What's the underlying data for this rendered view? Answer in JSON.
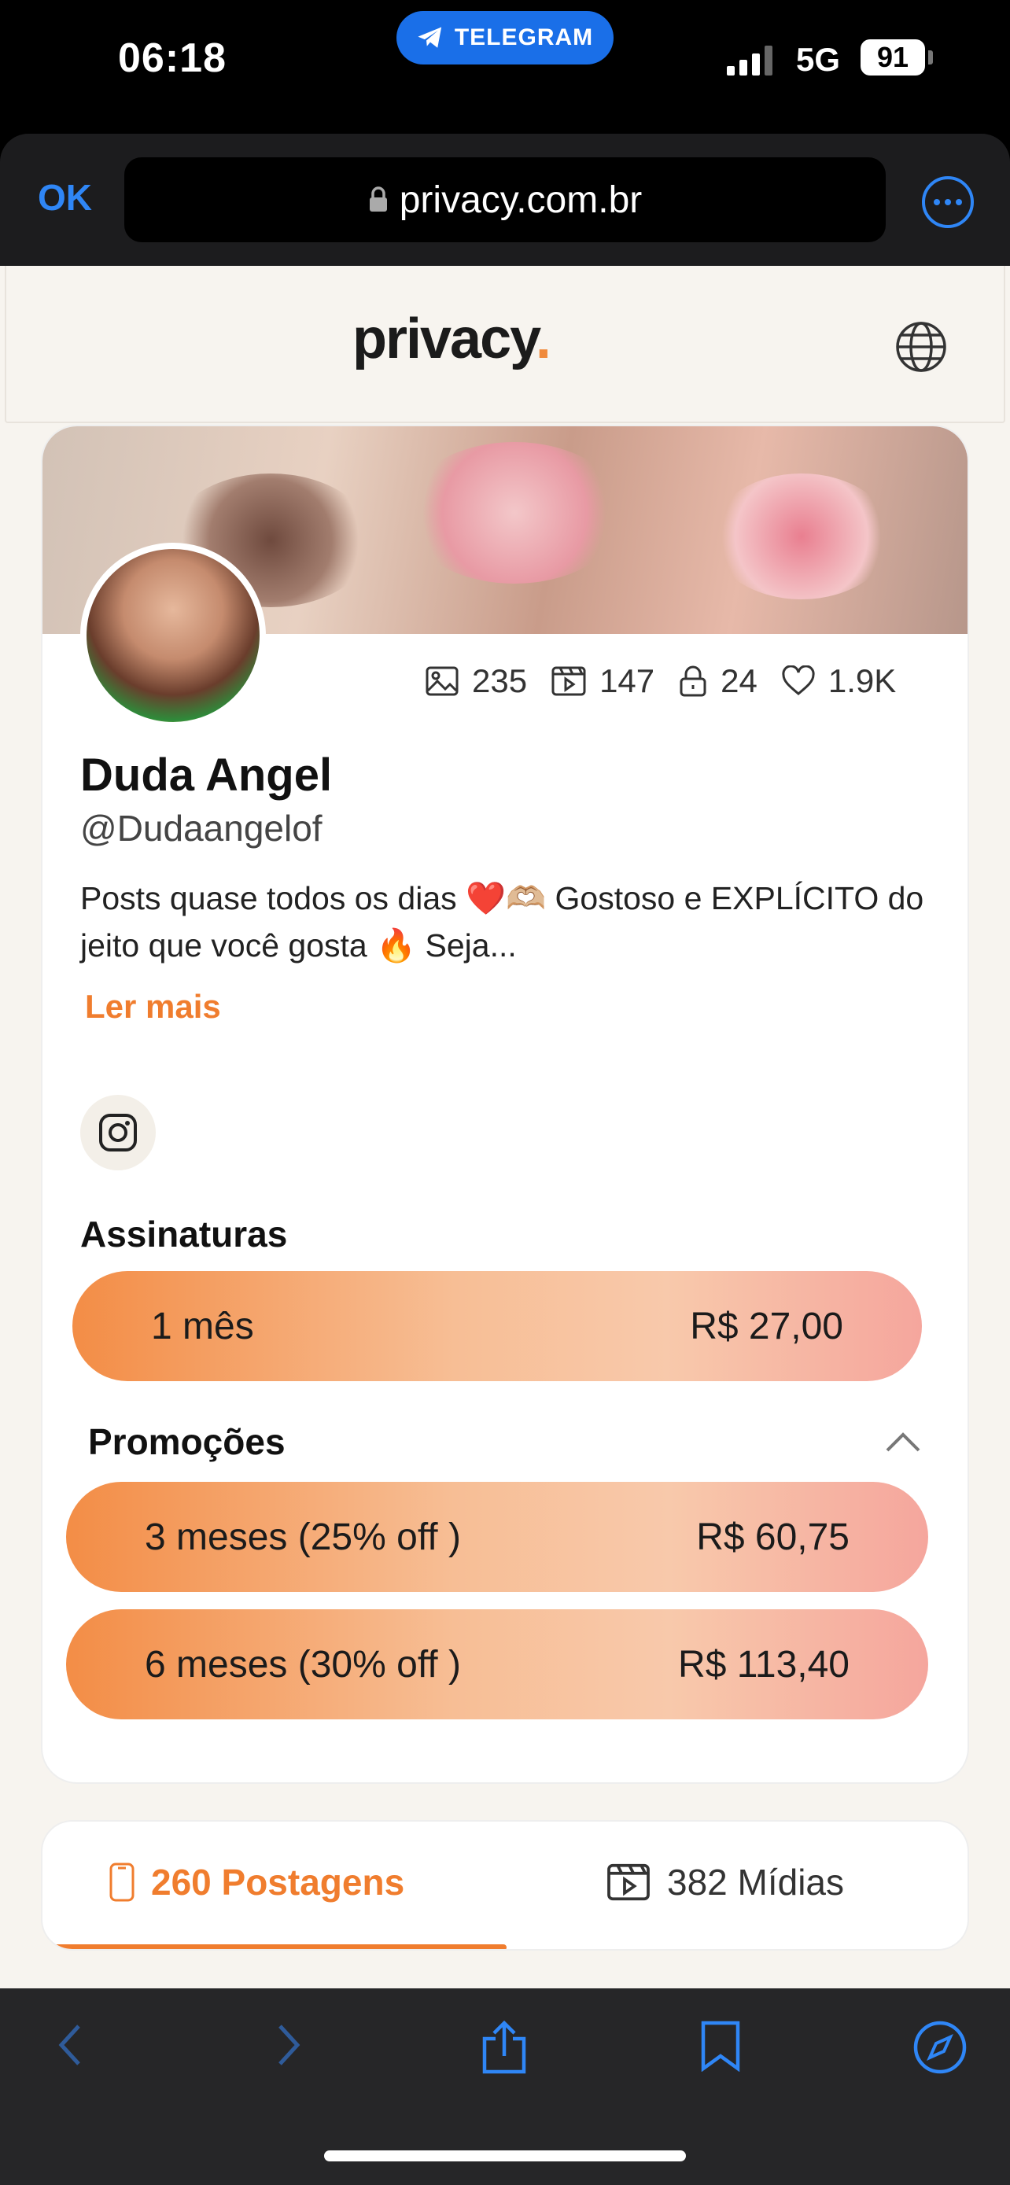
{
  "status_bar": {
    "time": "06:18",
    "pill_app": "TELEGRAM",
    "network": "5G",
    "battery": "91"
  },
  "browser": {
    "done_label": "OK",
    "url": "privacy.com.br"
  },
  "site": {
    "logo_text": "privacy",
    "logo_dot": "."
  },
  "profile": {
    "stats": [
      {
        "icon": "image-icon",
        "value": "235"
      },
      {
        "icon": "video-icon",
        "value": "147"
      },
      {
        "icon": "lock-icon",
        "value": "24"
      },
      {
        "icon": "heart-icon",
        "value": "1.9K"
      }
    ],
    "name": "Duda Angel",
    "handle": "@Dudaangelof",
    "bio": "Posts quase todos os dias ❤️🫶🏼 Gostoso e EXPLÍCITO do jeito que você gosta 🔥 Seja...",
    "read_more": "Ler mais",
    "social_icon": "instagram-icon"
  },
  "subscriptions": {
    "title": "Assinaturas",
    "plan": {
      "label": "1 mês",
      "price": "R$ 27,00"
    }
  },
  "promotions": {
    "title": "Promoções",
    "plans": [
      {
        "label": "3 meses (25% off )",
        "price": "R$ 60,75"
      },
      {
        "label": "6 meses (30% off )",
        "price": "R$ 113,40"
      }
    ]
  },
  "tabs": {
    "posts": "260 Postagens",
    "media": "382 Mídias",
    "active": "posts"
  },
  "colors": {
    "accent": "#f07d2e",
    "ios_blue": "#2f86f6",
    "telegram_blue": "#1a6fe8"
  }
}
